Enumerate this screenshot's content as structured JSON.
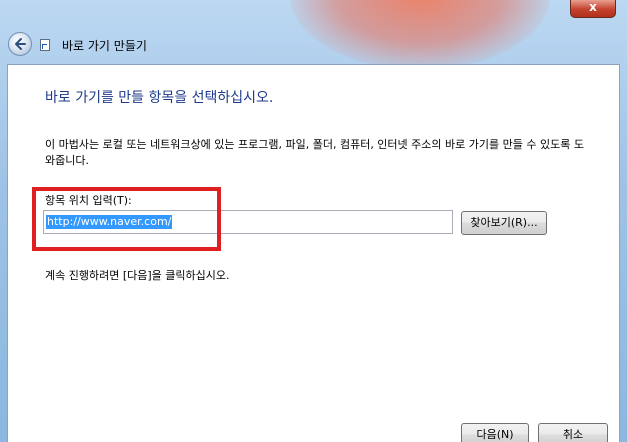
{
  "window": {
    "title": "바로 가기 만들기",
    "close_glyph": "x"
  },
  "icons": {
    "back": "back-arrow-icon",
    "shortcut": "shortcut-icon"
  },
  "main": {
    "heading": "바로 가기를 만들 항목을 선택하십시오.",
    "description": "이 마법사는 로컬 또는 네트워크상에 있는 프로그램, 파일, 폴더, 컴퓨터, 인터넷 주소의 바로 가기를 만들 수 있도록 도와줍니다.",
    "location_label": "항목 위치 입력(T):",
    "location_value": "http://www.naver.com/",
    "browse_label": "찾아보기(R)...",
    "continue_text": "계속 진행하려면 [다음]을 클릭하십시오."
  },
  "footer": {
    "next_label": "다음(N)",
    "cancel_label": "취소"
  },
  "colors": {
    "heading": "#1e3a8a",
    "highlight": "#e02020",
    "selection": "#3399ff"
  }
}
